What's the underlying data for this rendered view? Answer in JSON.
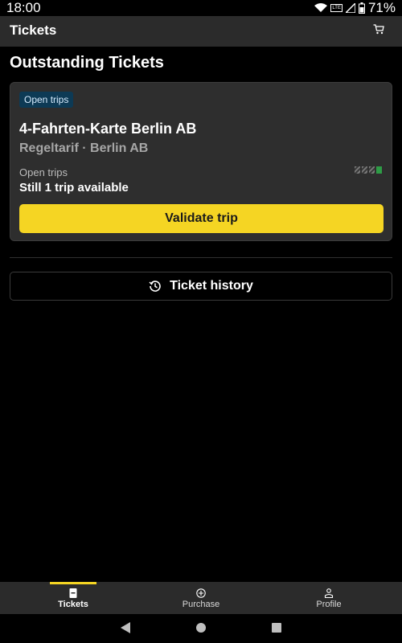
{
  "status": {
    "time": "18:00",
    "network": "LTE",
    "battery": "71%"
  },
  "appbar": {
    "title": "Tickets",
    "cart_icon": "cart-icon"
  },
  "main": {
    "section_title": "Outstanding Tickets",
    "ticket": {
      "badge": "Open trips",
      "title": "4-Fahrten-Karte Berlin AB",
      "subtitle": "Regeltarif · Berlin AB",
      "trips_label": "Open trips",
      "trips_value": "Still 1 trip available",
      "trips_used": 3,
      "trips_total": 4,
      "validate_label": "Validate trip"
    },
    "history_label": "Ticket history"
  },
  "nav": {
    "items": [
      {
        "label": "Tickets",
        "icon": "ticket-icon",
        "active": true
      },
      {
        "label": "Purchase",
        "icon": "plus-circle-icon",
        "active": false
      },
      {
        "label": "Profile",
        "icon": "person-icon",
        "active": false
      }
    ]
  },
  "colors": {
    "accent": "#f5d523",
    "badge_bg": "#0d3a55",
    "trip_available": "#2e9c46"
  }
}
